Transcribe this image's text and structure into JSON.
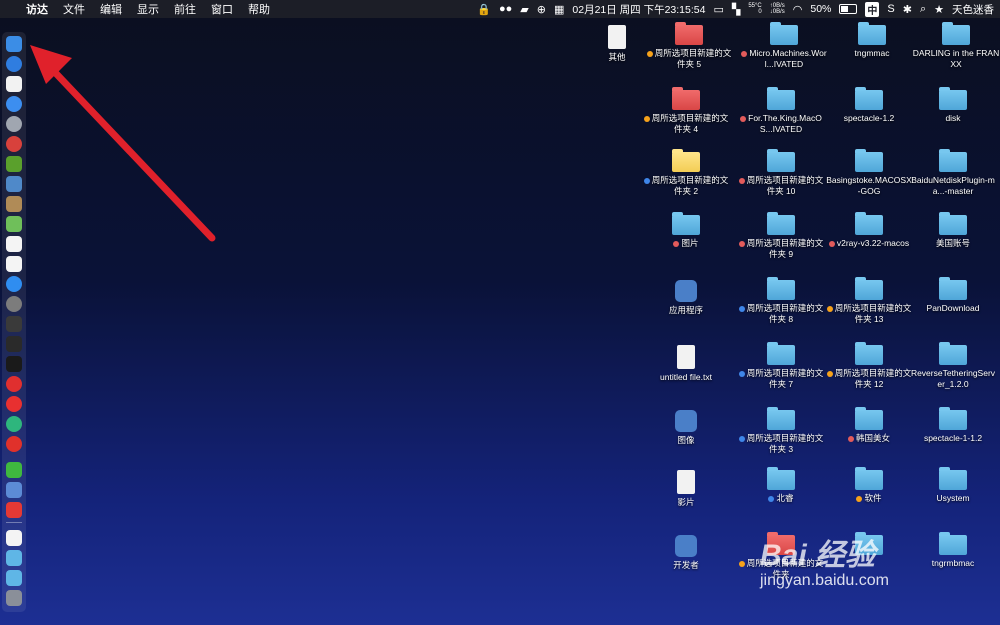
{
  "menubar": {
    "app_name": "访达",
    "menus": [
      "文件",
      "编辑",
      "显示",
      "前往",
      "窗口",
      "帮助"
    ],
    "status": {
      "network_up": "↑0B/s",
      "network_down": "↓0B/s",
      "cpu_temp": "55°C",
      "cpu_value": "0",
      "datetime": "02月21日 周四 下午23:15:54",
      "battery": "50%",
      "input_method": "中",
      "user_name": "天色迷香"
    }
  },
  "desktop": {
    "items": [
      {
        "label": "其他",
        "kind": "file"
      },
      {
        "label": "周所选项目新建的文件夹 5",
        "kind": "folder-red",
        "tag": "#f6a21b"
      },
      {
        "label": "Micro.Machines.Worl...IVATED",
        "kind": "folder",
        "tag": "#e25b5b"
      },
      {
        "label": "tngmmac",
        "kind": "folder"
      },
      {
        "label": "DARLING in the FRANXX",
        "kind": "folder"
      },
      {
        "label": "周所选项目新建的文件夹 4",
        "kind": "folder-red",
        "tag": "#f6a21b"
      },
      {
        "label": "For.The.King.MacOS...IVATED",
        "kind": "folder",
        "tag": "#e25b5b"
      },
      {
        "label": "spectacle-1.2",
        "kind": "folder"
      },
      {
        "label": "disk",
        "kind": "folder"
      },
      {
        "label": "周所选项目新建的文件夹 2",
        "kind": "folder-yellow",
        "tag": "#3f86e8"
      },
      {
        "label": "周所选项目新建的文件夹 10",
        "kind": "folder",
        "tag": "#e25b5b"
      },
      {
        "label": "Basingstoke.MACOSX-GOG",
        "kind": "folder"
      },
      {
        "label": "BaiduNetdiskPlugin-ma...-master",
        "kind": "folder"
      },
      {
        "label": "图片",
        "kind": "folder",
        "tag": "#e25b5b"
      },
      {
        "label": "周所选项目新建的文件夹 9",
        "kind": "folder",
        "tag": "#e25b5b"
      },
      {
        "label": "v2ray-v3.22-macos",
        "kind": "folder",
        "tag": "#e25b5b"
      },
      {
        "label": "美国账号",
        "kind": "folder"
      },
      {
        "label": "应用程序",
        "kind": "app"
      },
      {
        "label": "周所选项目新建的文件夹 8",
        "kind": "folder",
        "tag": "#3f86e8"
      },
      {
        "label": "周所选项目新建的文件夹 13",
        "kind": "folder",
        "tag": "#f6a21b"
      },
      {
        "label": "PanDownload",
        "kind": "folder"
      },
      {
        "label": "untitled file.txt",
        "kind": "file"
      },
      {
        "label": "周所选项目新建的文件夹 7",
        "kind": "folder",
        "tag": "#3f86e8"
      },
      {
        "label": "周所选项目新建的文件夹 12",
        "kind": "folder",
        "tag": "#f6a21b"
      },
      {
        "label": "ReverseTetheringServer_1.2.0",
        "kind": "folder"
      },
      {
        "label": "图像",
        "kind": "app"
      },
      {
        "label": "周所选项目新建的文件夹 3",
        "kind": "folder",
        "tag": "#3f86e8"
      },
      {
        "label": "韩国美女",
        "kind": "folder",
        "tag": "#e25b5b"
      },
      {
        "label": "spectacle-1-1.2",
        "kind": "folder"
      },
      {
        "label": "影片",
        "kind": "file"
      },
      {
        "label": "北睿",
        "kind": "folder",
        "tag": "#3f86e8"
      },
      {
        "label": "软件",
        "kind": "folder",
        "tag": "#f6a21b"
      },
      {
        "label": "Usystem",
        "kind": "folder"
      },
      {
        "label": "开发者",
        "kind": "app"
      },
      {
        "label": "周所选项目新建的文件夹",
        "kind": "folder-red",
        "tag": "#f6a21b"
      },
      {
        "label": "",
        "kind": "folder"
      },
      {
        "label": "tngrmbmac",
        "kind": "folder"
      }
    ]
  },
  "watermark": {
    "logo": "Bai 经验",
    "url": "jingyan.baidu.com"
  },
  "annotation": {
    "arrow_color": "#e0212b"
  },
  "colors": {
    "accent": "#e0212b",
    "folder": "#5fb6e6",
    "menubar": "#1c1e27"
  }
}
